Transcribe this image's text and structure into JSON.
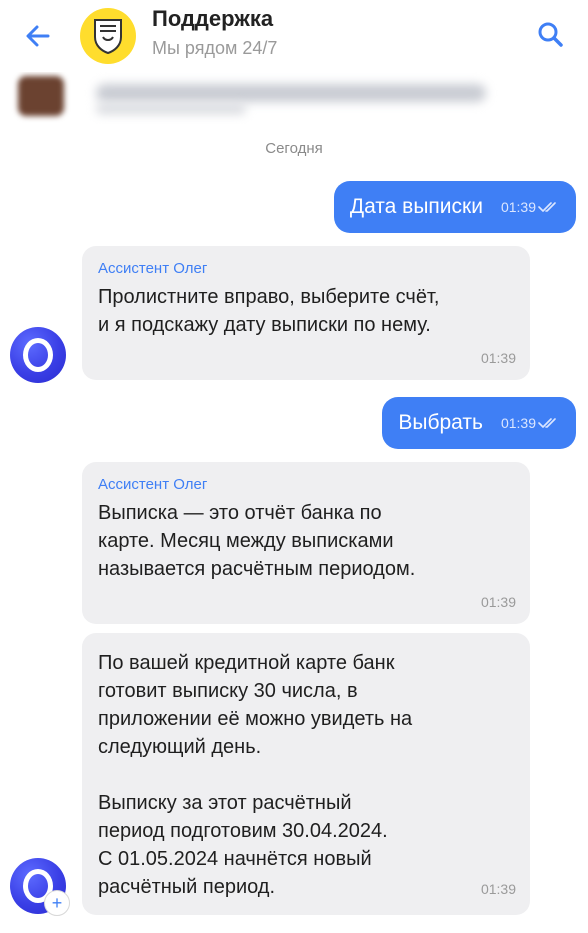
{
  "header": {
    "title": "Поддержка",
    "subtitle": "Мы рядом 24/7"
  },
  "colors": {
    "accent": "#3f7ff5",
    "logo_bg": "#ffdd2d",
    "bubble_in": "#efeff1"
  },
  "day_separator": "Сегодня",
  "messages": [
    {
      "type": "outgoing",
      "text": "Дата выписки",
      "time": "01:39"
    },
    {
      "type": "incoming",
      "sender": "Ассистент Олег",
      "text": "Пролистните вправо, выберите счёт,\nи я подскажу дату выписки по нему.",
      "time": "01:39"
    },
    {
      "type": "outgoing",
      "text": "Выбрать",
      "time": "01:39"
    },
    {
      "type": "incoming",
      "sender": "Ассистент Олег",
      "text": "Выписка — это отчёт банка по\nкарте. Месяц между выписками\nназывается расчётным периодом.",
      "time": "01:39"
    },
    {
      "type": "incoming",
      "text": "По вашей кредитной карте банк\nготовит выписку 30 числа, в\nприложении её можно увидеть на\nследующий день.\n\nВыписку за этот расчётный\nпериод подготовим 30.04.2024.\nС 01.05.2024 начнётся новый\nрасчётный период.",
      "time": "01:39"
    }
  ],
  "avatar_badge": "+"
}
